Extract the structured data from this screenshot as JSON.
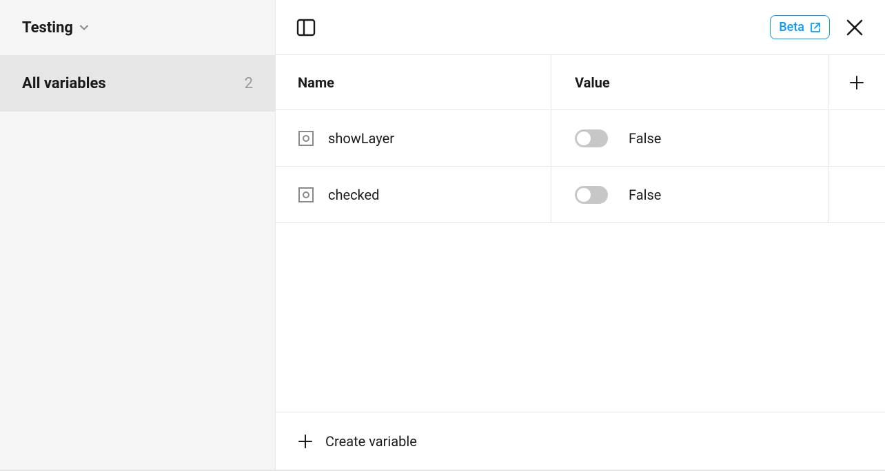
{
  "sidebar": {
    "collection_title": "Testing",
    "groups": [
      {
        "label": "All variables",
        "count": "2"
      }
    ]
  },
  "topbar": {
    "beta_label": "Beta"
  },
  "table": {
    "headers": {
      "name": "Name",
      "value": "Value"
    },
    "rows": [
      {
        "name": "showLayer",
        "value_label": "False",
        "value": false
      },
      {
        "name": "checked",
        "value_label": "False",
        "value": false
      }
    ]
  },
  "footer": {
    "create_label": "Create variable"
  }
}
